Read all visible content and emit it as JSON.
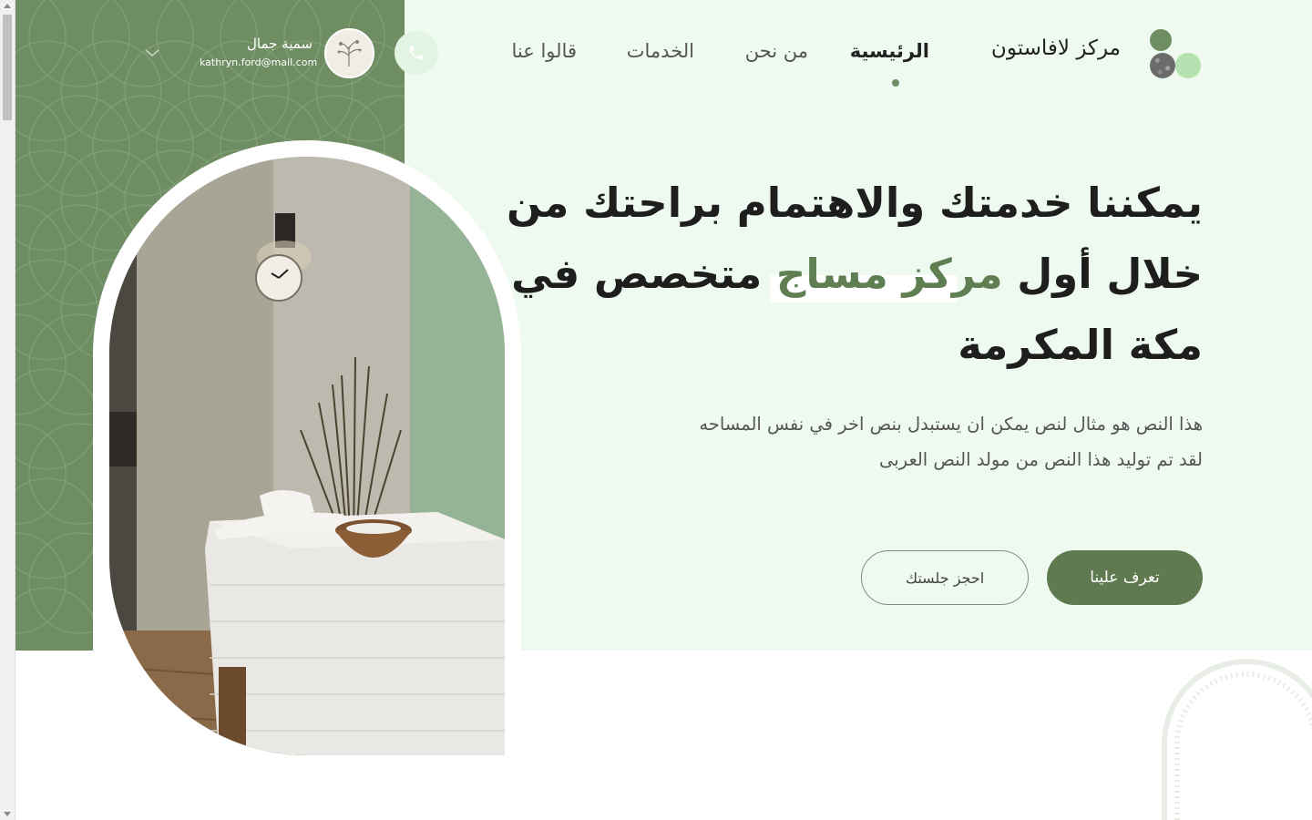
{
  "brand": {
    "name": "مركز لافاستون"
  },
  "nav": {
    "items": [
      {
        "label": "الرئيسية",
        "active": true
      },
      {
        "label": "من نحن",
        "active": false
      },
      {
        "label": "الخدمات",
        "active": false
      },
      {
        "label": "قالوا عنا",
        "active": false
      }
    ]
  },
  "user": {
    "name": "سمية جمال",
    "email": "kathryn.ford@mail.com"
  },
  "hero": {
    "heading_line1": "يمكننا خدمتك والاهتمام براحتك من",
    "heading_line2_before": "خلال أول ",
    "heading_line2_accent": "مركز مساج",
    "heading_line2_after": " متخصص في",
    "heading_line3": "مكة المكرمة",
    "paragraph_line1": "هذا النص هو مثال لنص يمكن ان يستبدل بنص اخر في نفس المساحه",
    "paragraph_line2": "لقد تم توليد هذا النص من مولد النص العربى",
    "primary_button": "تعرف علينا",
    "secondary_button": "احجز جلستك"
  },
  "colors": {
    "accent_green": "#6e8d63",
    "hero_background": "#eefaef",
    "button_green": "#5f7950",
    "logo_light_green": "#b5e1b0"
  },
  "icons": {
    "phone": "phone-icon",
    "chevron": "chevron-down-icon"
  }
}
